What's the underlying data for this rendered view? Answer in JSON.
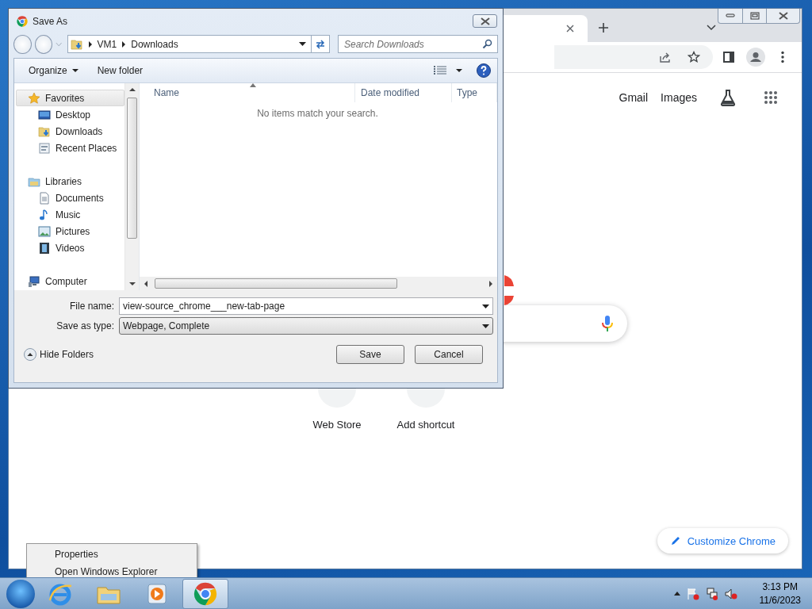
{
  "browser": {
    "header_links": [
      "Gmail",
      "Images"
    ],
    "shortcuts": [
      {
        "label": "Web Store"
      },
      {
        "label": "Add shortcut"
      }
    ],
    "customize_button": "Customize Chrome"
  },
  "dialog": {
    "title": "Save As",
    "breadcrumb": [
      "VM1",
      "Downloads"
    ],
    "search": {
      "placeholder": "Search Downloads"
    },
    "toolbar": [
      "Organize",
      "New folder"
    ],
    "sidebar": [
      {
        "label": "Favorites",
        "kind": "star",
        "selected": true,
        "children": [
          {
            "label": "Desktop",
            "kind": "desktop",
            "selected": false
          },
          {
            "label": "Downloads",
            "kind": "downloads",
            "selected": false
          },
          {
            "label": "Recent Places",
            "kind": "recent",
            "selected": false
          }
        ]
      },
      {
        "label": "Libraries",
        "kind": "library",
        "selected": false,
        "children": [
          {
            "label": "Documents",
            "kind": "documents",
            "selected": false
          },
          {
            "label": "Music",
            "kind": "music",
            "selected": false
          },
          {
            "label": "Pictures",
            "kind": "pictures",
            "selected": false
          },
          {
            "label": "Videos",
            "kind": "videos",
            "selected": false
          }
        ]
      },
      {
        "label": "Computer",
        "kind": "computer",
        "selected": false
      }
    ],
    "columns": [
      "Name",
      "Date modified",
      "Type"
    ],
    "empty_message": "No items match your search.",
    "fields": [
      {
        "label": "File name:",
        "value": "view-source_chrome___new-tab-page",
        "kind": "input"
      },
      {
        "label": "Save as type:",
        "value": "Webpage, Complete",
        "kind": "select"
      }
    ],
    "hide_folders": "Hide Folders",
    "buttons": [
      "Save",
      "Cancel"
    ]
  },
  "context_menu": [
    "Properties",
    "Open Windows Explorer"
  ],
  "taskbar": {
    "apps": [
      {
        "kind": "ie",
        "selected": false
      },
      {
        "kind": "explorer",
        "selected": false
      },
      {
        "kind": "media",
        "selected": false
      },
      {
        "kind": "chrome",
        "selected": true
      }
    ],
    "clock": {
      "time": "3:13 PM",
      "date": "11/6/2023"
    }
  }
}
